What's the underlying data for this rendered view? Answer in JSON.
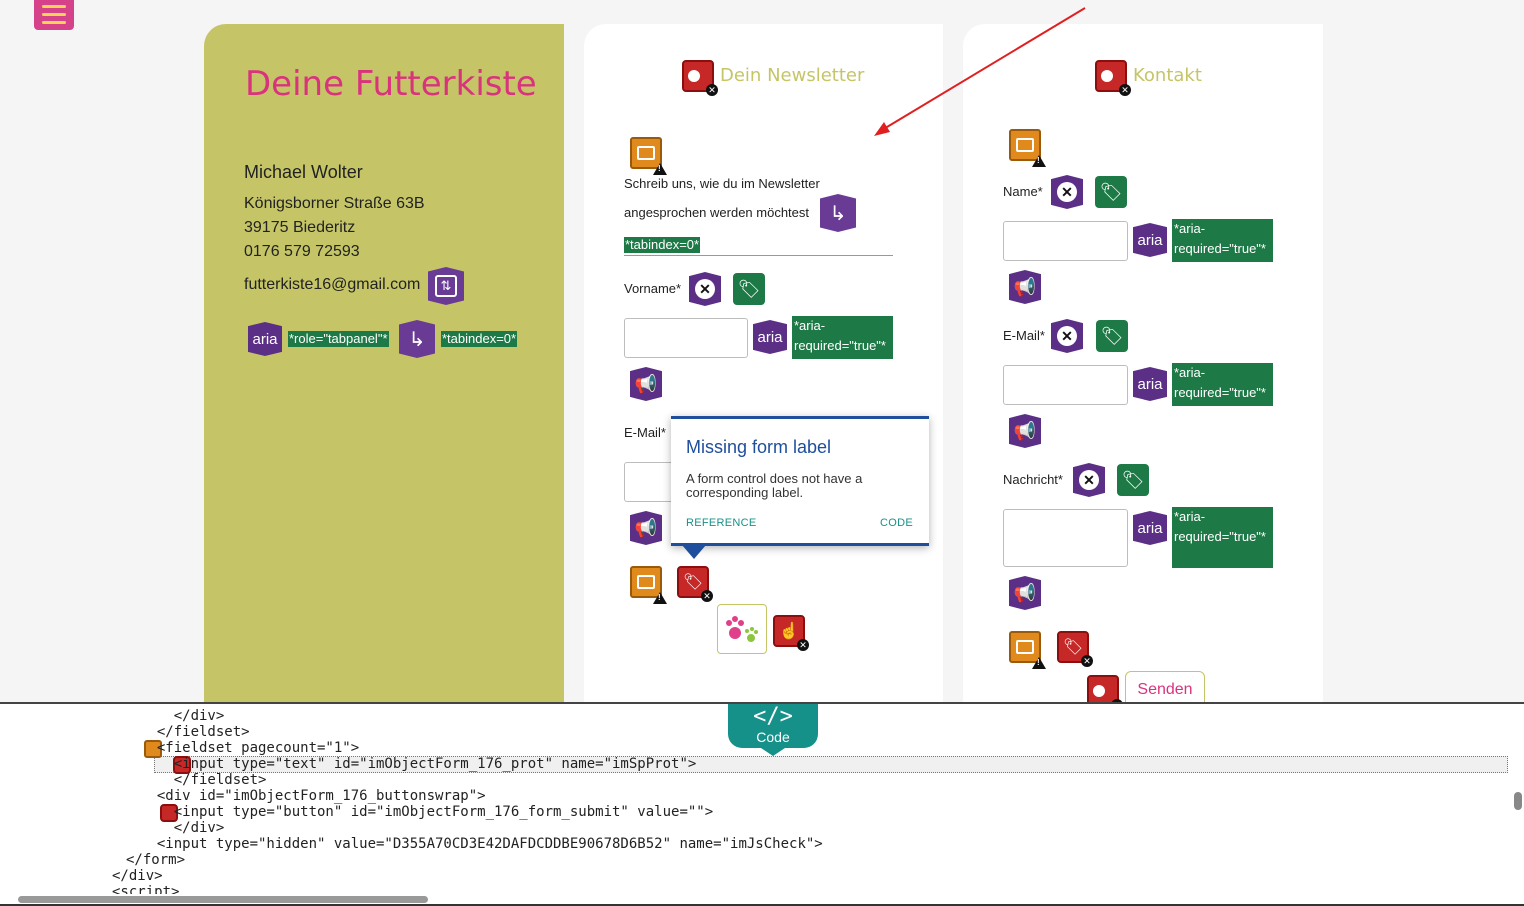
{
  "brand": {
    "title": "Deine Futterkiste"
  },
  "address": {
    "name": "Michael Wolter",
    "street": "Königsborner Straße 63B",
    "city": "39175 Biederitz",
    "phone": "0176 579 72593",
    "email": "futterkiste16@gmail.com",
    "role_tag": "*role=\"tabpanel\"*",
    "tabindex_tag": "*tabindex=0*",
    "aria_label": "aria"
  },
  "newsletter": {
    "heading": "Dein Newsletter",
    "line1": "Schreib uns, wie du im Newsletter",
    "line2": "angesprochen werden möchtest",
    "tabindex_tag": "*tabindex=0*",
    "firstname_label": "Vorname*",
    "email_label": "E-Mail*",
    "aria_label": "aria",
    "aria_required_1": "*aria-",
    "aria_required_2": "required=\"true\"*"
  },
  "contact": {
    "heading": "Kontakt",
    "name_label": "Name*",
    "email_label": "E-Mail*",
    "message_label": "Nachricht*",
    "aria_label": "aria",
    "aria_required_1": "*aria-",
    "aria_required_2": "required=\"true\"*",
    "submit": "Senden"
  },
  "popup": {
    "title": "Missing form label",
    "text": "A form control does not have a corresponding label.",
    "reference": "REFERENCE",
    "code": "CODE"
  },
  "code_panel": {
    "badge_symbol": "</>",
    "badge_label": "Code",
    "lines": [
      "    </div>",
      "  </fieldset>",
      "  <fieldset pagecount=\"1\">",
      "    <input type=\"text\" id=\"imObjectForm_176_prot\" name=\"imSpProt\">",
      "    </fieldset>",
      "  <div id=\"imObjectForm_176_buttonswrap\">",
      "    <input type=\"button\" id=\"imObjectForm_176_form_submit\" value=\"\">",
      "    </div>",
      "  <input type=\"hidden\" value=\"D355A70CD3E42DAFDCDDBE90678D6B52\" name=\"imJsCheck\">",
      "</form>",
      "</div>",
      "<script>"
    ]
  },
  "colors": {
    "brand_pink": "#d9337e",
    "olive": "#c5c567",
    "aria_green": "#1d7a46",
    "wave_purple": "#5c2f87",
    "error_red": "#c62828",
    "alert_orange": "#e08a1e",
    "popup_blue": "#1e4e9c",
    "code_teal": "#16918a"
  }
}
